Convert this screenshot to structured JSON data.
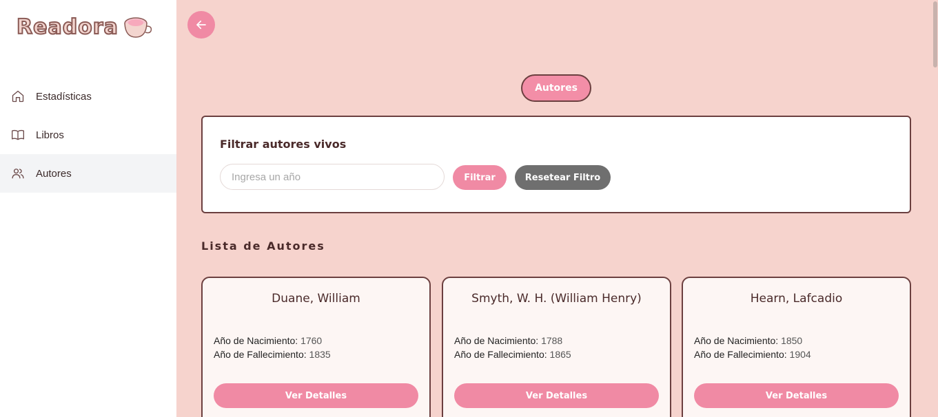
{
  "app": {
    "logo_text": "Readora"
  },
  "sidebar": {
    "items": [
      {
        "label": "Estadísticas",
        "icon": "home-icon",
        "active": false
      },
      {
        "label": "Libros",
        "icon": "book-icon",
        "active": false
      },
      {
        "label": "Autores",
        "icon": "users-icon",
        "active": true
      }
    ]
  },
  "header": {
    "page_pill": "Autores"
  },
  "filter": {
    "title": "Filtrar autores vivos",
    "placeholder": "Ingresa un año",
    "value": "",
    "filter_label": "Filtrar",
    "reset_label": "Resetear Filtro"
  },
  "list": {
    "title": "Lista de Autores",
    "birth_label": "Año de Nacimiento:",
    "death_label": "Año de Fallecimiento:",
    "button_label": "Ver Detalles",
    "authors": [
      {
        "name": "Duane, William",
        "birth": "1760",
        "death": "1835"
      },
      {
        "name": "Smyth, W. H. (William Henry)",
        "birth": "1788",
        "death": "1865"
      },
      {
        "name": "Hearn, Lafcadio",
        "birth": "1850",
        "death": "1904"
      }
    ]
  },
  "colors": {
    "background": "#f6d3cd",
    "accent": "#f08aa4",
    "border": "#6b3f3f",
    "reset_button": "#6f6f6f"
  }
}
